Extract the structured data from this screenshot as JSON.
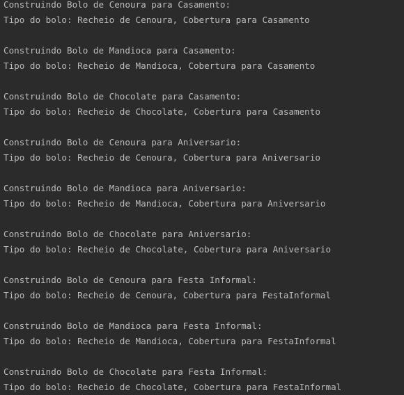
{
  "console": {
    "lines": [
      "Construindo Bolo de Cenoura para Casamento:",
      "Tipo do bolo: Recheio de Cenoura, Cobertura para Casamento",
      "",
      "Construindo Bolo de Mandioca para Casamento:",
      "Tipo do bolo: Recheio de Mandioca, Cobertura para Casamento",
      "",
      "Construindo Bolo de Chocolate para Casamento:",
      "Tipo do bolo: Recheio de Chocolate, Cobertura para Casamento",
      "",
      "Construindo Bolo de Cenoura para Aniversario:",
      "Tipo do bolo: Recheio de Cenoura, Cobertura para Aniversario",
      "",
      "Construindo Bolo de Mandioca para Aniversario:",
      "Tipo do bolo: Recheio de Mandioca, Cobertura para Aniversario",
      "",
      "Construindo Bolo de Chocolate para Aniversario:",
      "Tipo do bolo: Recheio de Chocolate, Cobertura para Aniversario",
      "",
      "Construindo Bolo de Cenoura para Festa Informal:",
      "Tipo do bolo: Recheio de Cenoura, Cobertura para FestaInformal",
      "",
      "Construindo Bolo de Mandioca para Festa Informal:",
      "Tipo do bolo: Recheio de Mandioca, Cobertura para FestaInformal",
      "",
      "Construindo Bolo de Chocolate para Festa Informal:",
      "Tipo do bolo: Recheio de Chocolate, Cobertura para FestaInformal"
    ]
  }
}
